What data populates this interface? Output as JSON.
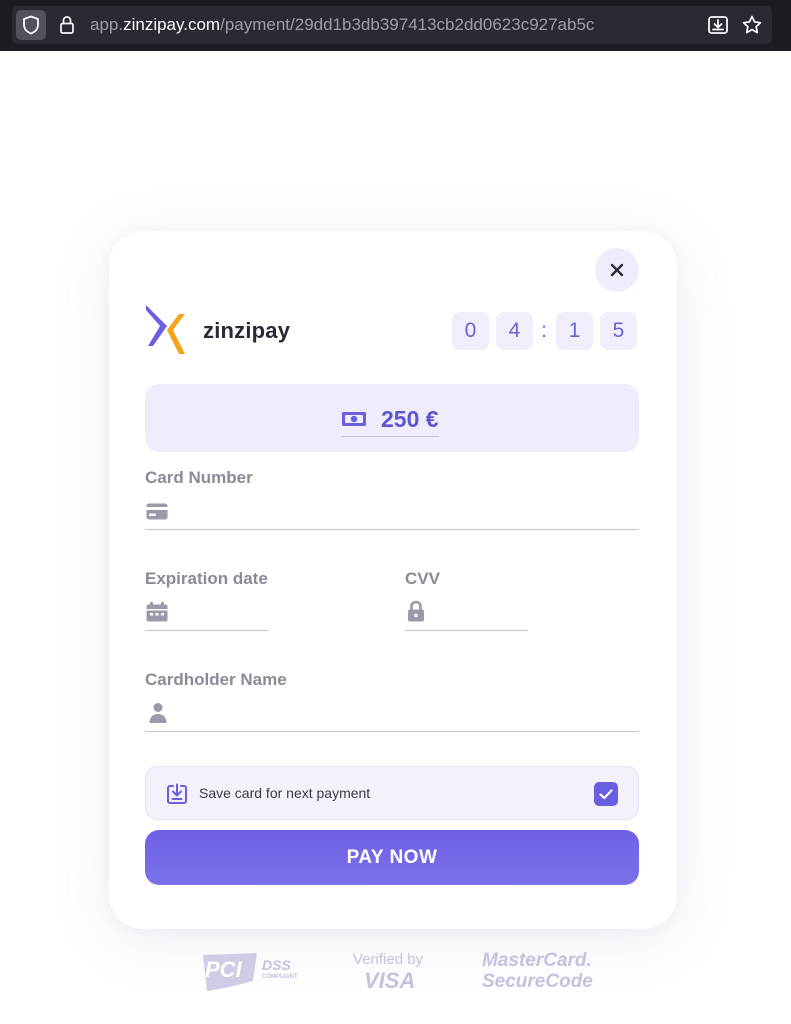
{
  "browser": {
    "url_host_prefix": "app.",
    "url_host": "zinzipay.com",
    "url_path": "/payment/29dd1b3db397413cb2dd0623c927ab5c"
  },
  "brand": {
    "name": "zinzipay",
    "accent": "#6a5fe0"
  },
  "timer": {
    "d1": "0",
    "d2": "4",
    "sep": ":",
    "d3": "1",
    "d4": "5"
  },
  "amount": {
    "value": "250 €",
    "icon": "banknote-icon"
  },
  "fields": {
    "card_number": {
      "label": "Card Number",
      "value": "",
      "icon": "credit-card-icon"
    },
    "expiration": {
      "label": "Expiration date",
      "value": "",
      "icon": "calendar-icon"
    },
    "cvv": {
      "label": "CVV",
      "value": "",
      "icon": "lock-icon"
    },
    "cardholder": {
      "label": "Cardholder Name",
      "value": "",
      "icon": "user-icon"
    }
  },
  "save_card": {
    "label": "Save card for next payment",
    "checked": true
  },
  "pay_button": {
    "label": "PAY NOW"
  },
  "badges": {
    "pci": "PCI",
    "dss": "DSS",
    "dss_sub": "COMPLIANT",
    "visa_top": "Verified by",
    "visa": "VISA",
    "mc_top": "MasterCard.",
    "mc_bottom": "SecureCode"
  }
}
